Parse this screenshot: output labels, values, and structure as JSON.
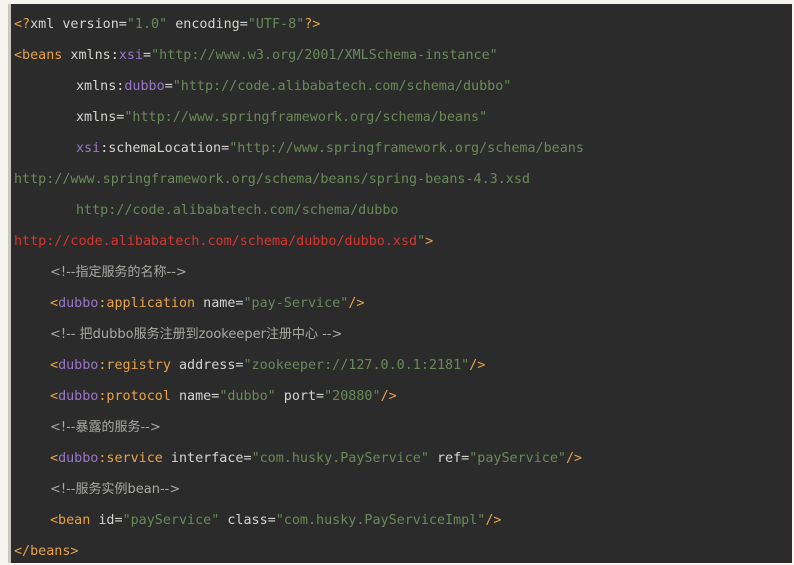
{
  "lines": [
    {
      "parts": [
        "<?",
        "xml",
        " version=",
        "\"1.0\"",
        " encoding=",
        "\"UTF-8\"",
        "?>"
      ]
    },
    {
      "parts": [
        "<beans",
        " xmlns:",
        "xsi",
        "=",
        "\"http://www.w3.org/2001/XMLSchema-instance\""
      ]
    },
    {
      "parts": [
        "xmlns:",
        "dubbo",
        "=",
        "\"http://code.alibabatech.com/schema/dubbo\""
      ]
    },
    {
      "parts": [
        "xmlns=",
        "\"http://www.springframework.org/schema/beans\""
      ]
    },
    {
      "parts": [
        "xsi",
        ":schemaLocation=",
        "\"http://www.springframework.org/schema/beans"
      ]
    },
    {
      "parts": [
        "http://www.springframework.org/schema/beans/spring-beans-4.3.xsd"
      ]
    },
    {
      "parts": [
        "http://code.alibabatech.com/schema/dubbo"
      ]
    },
    {
      "parts": [
        "http://code.alibabatech.com/schema/dubbo/dubbo.xsd",
        "\"",
        ">"
      ]
    },
    {
      "parts": [
        "<!--指定服务的名称-->"
      ]
    },
    {
      "parts": [
        "<",
        "dubbo",
        ":application",
        " name=",
        "\"pay-Service\"",
        "/>"
      ]
    },
    {
      "parts": [
        "<!-- 把dubbo服务注册到zookeeper注册中心 -->"
      ]
    },
    {
      "parts": [
        "<",
        "dubbo",
        ":registry",
        " address=",
        "\"zookeeper://127.0.0.1:2181\"",
        "/>"
      ]
    },
    {
      "parts": [
        "<",
        "dubbo",
        ":protocol",
        " name=",
        "\"dubbo\"",
        " port=",
        "\"20880\"",
        "/>"
      ]
    },
    {
      "parts": [
        "<!--暴露的服务-->"
      ]
    },
    {
      "parts": [
        "<",
        "dubbo",
        ":service",
        " interface=",
        "\"com.husky.PayService\"",
        " ref=",
        "\"payService\"",
        "/>"
      ]
    },
    {
      "parts": [
        "<!--服务实例bean-->"
      ]
    },
    {
      "parts": [
        "<bean",
        " id=",
        "\"payService\"",
        " class=",
        "\"com.husky.PayServiceImpl\"",
        "/>"
      ]
    },
    {
      "parts": [
        "</beans>"
      ]
    }
  ],
  "colors": {
    "background": "#2b2b2b",
    "tag": "#e7a349",
    "namespace": "#9b76c8",
    "string": "#6a8a59",
    "comment": "#a9a9a4",
    "schema_url": "#d8352f"
  }
}
